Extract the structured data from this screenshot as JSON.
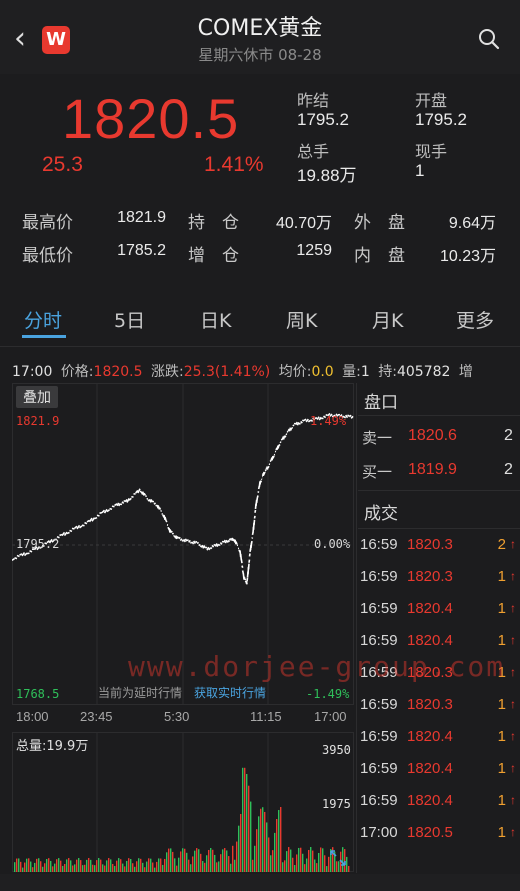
{
  "header": {
    "title": "COMEX黄金",
    "subtitle": "星期六休市 08-28",
    "logo_text": "W",
    "back_glyph": "‹"
  },
  "quote": {
    "price": "1820.5",
    "change": "25.3",
    "change_pct": "1.41%",
    "prev_close_label": "昨结",
    "prev_close": "1795.2",
    "open_label": "开盘",
    "open": "1795.2",
    "total_vol_label": "总手",
    "total_vol": "19.88万",
    "current_vol_label": "现手",
    "current_vol": "1"
  },
  "stats": {
    "high_label": "最高价",
    "high": "1821.9",
    "low_label": "最低价",
    "low": "1785.2",
    "oi_label": "持　仓",
    "oi": "40.70万",
    "oi_inc_label": "增　仓",
    "oi_inc": "1259",
    "outer_label": "外　盘",
    "outer": "9.64万",
    "inner_label": "内　盘",
    "inner": "10.23万"
  },
  "tabs": [
    "分时",
    "5日",
    "日K",
    "周K",
    "月K",
    "更多"
  ],
  "infobar": {
    "time": "17:00",
    "price_label": "价格:",
    "price": "1820.5",
    "chg_label": "涨跌:",
    "chg": "25.3(1.41%)",
    "avg_label": "均价:",
    "avg": "0.0",
    "vol_label": "量:",
    "vol": "1",
    "hold_label": "持:",
    "hold": "405782",
    "inc_label": "增"
  },
  "chart": {
    "overlay_label": "叠加",
    "y_top": "1821.9",
    "y_mid": "1795.2",
    "y_bot": "1768.5",
    "pct_top": "1.49%",
    "pct_mid": "0.00%",
    "pct_bot": "-1.49%",
    "delay_note": "当前为延时行情",
    "realtime_link": "获取实时行情",
    "x_ticks": [
      "18:00",
      "23:45",
      "5:30",
      "11:15",
      "17:00"
    ],
    "vol_label": "总量:19.9万",
    "vol_top": "3950",
    "vol_mid": "1975"
  },
  "side": {
    "book_title": "盘口",
    "ask_label": "卖一",
    "ask_price": "1820.6",
    "ask_qty": "2",
    "bid_label": "买一",
    "bid_price": "1819.9",
    "bid_qty": "2",
    "trades_title": "成交",
    "trades": [
      {
        "time": "16:59",
        "price": "1820.3",
        "qty": "2"
      },
      {
        "time": "16:59",
        "price": "1820.3",
        "qty": "1"
      },
      {
        "time": "16:59",
        "price": "1820.4",
        "qty": "1"
      },
      {
        "time": "16:59",
        "price": "1820.4",
        "qty": "1"
      },
      {
        "time": "16:59",
        "price": "1820.3",
        "qty": "1"
      },
      {
        "time": "16:59",
        "price": "1820.3",
        "qty": "1"
      },
      {
        "time": "16:59",
        "price": "1820.4",
        "qty": "1"
      },
      {
        "time": "16:59",
        "price": "1820.4",
        "qty": "1"
      },
      {
        "time": "16:59",
        "price": "1820.4",
        "qty": "1"
      },
      {
        "time": "17:00",
        "price": "1820.5",
        "qty": "1"
      }
    ],
    "arrow": "↑"
  },
  "watermark": "www.dorjee-group.com",
  "colors": {
    "up": "#e8392f",
    "down": "#2fbf5a",
    "accent": "#4aa3df",
    "line": "#ffffff"
  }
}
